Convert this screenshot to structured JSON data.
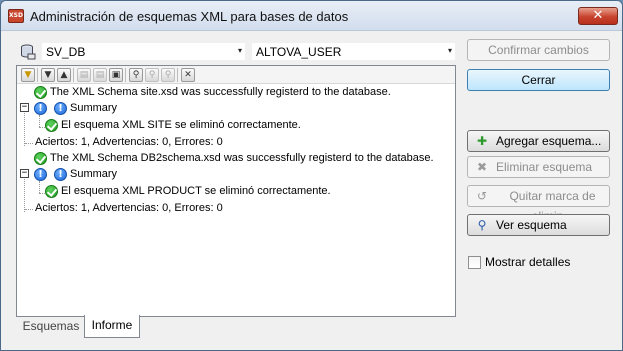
{
  "window": {
    "title": "Administración de esquemas XML para bases de datos",
    "app_icon_text": "XSD",
    "close_glyph": "✕"
  },
  "selectors": {
    "database": "SV_DB",
    "schema": "ALTOVA_USER",
    "arrow_glyph": "▾"
  },
  "toolbar": {
    "buttons": [
      "filter-icon",
      "expand-icon",
      "collapse-icon",
      "copy-icon",
      "copy-all-icon",
      "save-icon",
      "find-icon",
      "find-next-icon",
      "find-prev-icon",
      "clear-icon"
    ]
  },
  "messages": {
    "line1": "The XML Schema site.xsd was successfully registerd to the database.",
    "summary1": "Summary",
    "detail1": "El esquema XML SITE se eliminó correctamente.",
    "counts1": "Aciertos: 1, Advertencias: 0, Errores: 0",
    "line2": "The XML Schema DB2schema.xsd was successfully registerd to the database.",
    "summary2": "Summary",
    "detail2": "El esquema XML PRODUCT se eliminó correctamente.",
    "counts2": "Aciertos: 1, Advertencias: 0, Errores: 0"
  },
  "tabs": {
    "schemas": "Esquemas",
    "report": "Informe",
    "active": "Informe"
  },
  "buttons": {
    "confirm": "Confirmar cambios",
    "close": "Cerrar",
    "add": "Agregar esquema...",
    "remove": "Eliminar esquema",
    "unmark": "Quitar marca de elimin...",
    "view": "Ver esquema"
  },
  "show_details": {
    "label": "Mostrar detalles",
    "checked": false
  }
}
